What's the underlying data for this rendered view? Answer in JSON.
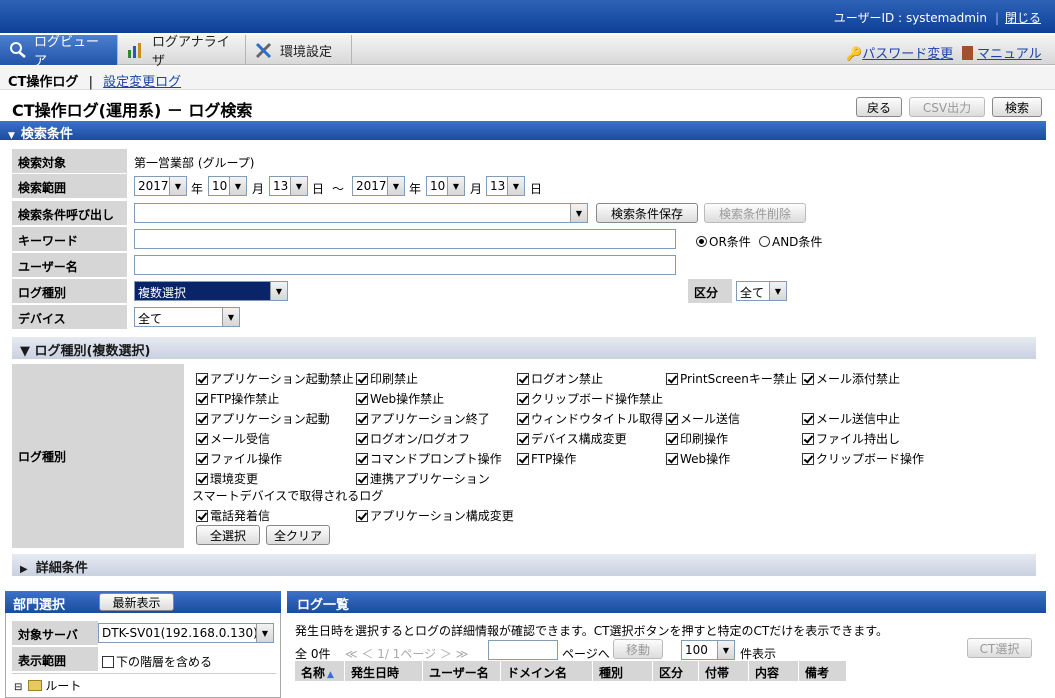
{
  "topbar": {
    "user_label": "ユーザーID : systemadmin",
    "close_link": "閉じる"
  },
  "nav": {
    "tabs": [
      {
        "label": "ログビューア",
        "icon": "log-viewer-icon"
      },
      {
        "label": "ログアナライザ",
        "icon": "chart-icon"
      },
      {
        "label": "環境設定",
        "icon": "tools-icon"
      }
    ],
    "password_link": "パスワード変更",
    "manual_link": "マニュアル"
  },
  "subnav": {
    "current": "CT操作ログ",
    "separator": "|",
    "link": "設定変更ログ"
  },
  "title": {
    "text": "CT操作ログ(運用系) － ログ検索",
    "back_button": "戻る",
    "csv_button": "CSV出力",
    "search_button": "検索"
  },
  "search": {
    "section_title": "検索条件",
    "target_label": "検索対象",
    "target_value": "第一営業部 (グループ)",
    "range_label": "検索範囲",
    "range": {
      "from_year": "2017",
      "from_month": "10",
      "from_day": "13",
      "to_year": "2017",
      "to_month": "10",
      "to_day": "13",
      "year_unit": "年",
      "month_unit": "月",
      "day_unit": "日",
      "tilde": "～"
    },
    "recall_label": "検索条件呼び出し",
    "recall_save": "検索条件保存",
    "recall_delete": "検索条件削除",
    "keyword_label": "キーワード",
    "or_label": "OR条件",
    "and_label": "AND条件",
    "user_label": "ユーザー名",
    "logtype_label": "ログ種別",
    "logtype_value": "複数選択",
    "kubun_label": "区分",
    "kubun_value": "全て",
    "device_label": "デバイス",
    "device_value": "全て"
  },
  "logtypes": {
    "section_title": "▼ ログ種別(複数選択)",
    "label": "ログ種別",
    "rows": [
      [
        "アプリケーション起動禁止",
        "印刷禁止",
        "ログオン禁止",
        "PrintScreenキー禁止",
        "メール添付禁止"
      ],
      [
        "FTP操作禁止",
        "Web操作禁止",
        "クリップボード操作禁止"
      ],
      [
        "アプリケーション起動",
        "アプリケーション終了",
        "ウィンドウタイトル取得",
        "メール送信",
        "メール送信中止"
      ],
      [
        "メール受信",
        "ログオン/ログオフ",
        "デバイス構成変更",
        "印刷操作",
        "ファイル持出し"
      ],
      [
        "ファイル操作",
        "コマンドプロンプト操作",
        "FTP操作",
        "Web操作",
        "クリップボード操作"
      ],
      [
        "環境変更",
        "連携アプリケーション"
      ]
    ],
    "smart_title": "スマートデバイスで取得されるログ",
    "smart_row": [
      "電話発着信",
      "アプリケーション構成変更"
    ],
    "select_all": "全選択",
    "clear_all": "全クリア"
  },
  "detail": {
    "title": "詳細条件"
  },
  "dept": {
    "title": "部門選択",
    "refresh_button": "最新表示",
    "server_label": "対象サーバ",
    "server_value": "DTK-SV01(192.168.0.130)",
    "range_label": "表示範囲",
    "include_lower": "下の階層を含める",
    "tree_root": "ルート"
  },
  "loglist": {
    "title": "ログ一覧",
    "info": "発生日時を選択するとログの詳細情報が確認できます。CT選択ボタンを押すと特定のCTだけを表示できます。",
    "total": "全 0件",
    "pager": "≪ ＜ 1/ 1ページ ＞ ≫",
    "page_goto": "ページへ",
    "move_button": "移動",
    "per_page": "100",
    "per_page_unit": "件表示",
    "ct_button": "CT選択",
    "columns": [
      "名称",
      "発生日時",
      "ユーザー名",
      "ドメイン名",
      "種別",
      "区分",
      "付帯",
      "内容",
      "備考"
    ]
  }
}
